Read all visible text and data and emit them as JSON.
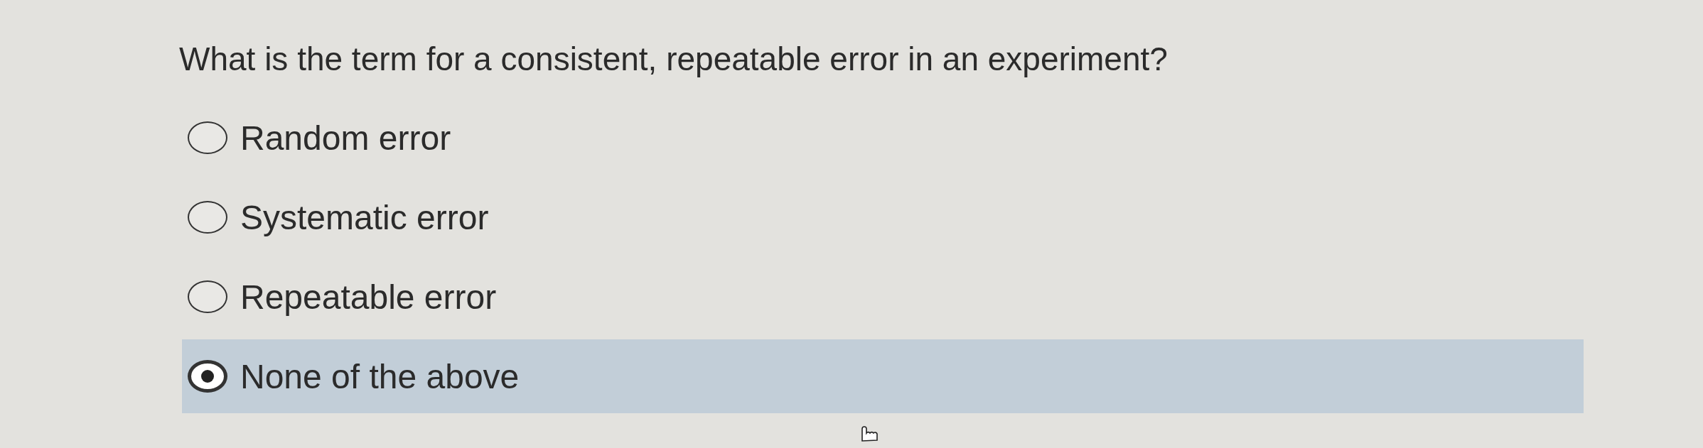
{
  "question": "What is the term for a consistent, repeatable error in an experiment?",
  "options": [
    {
      "label": "Random error",
      "selected": false
    },
    {
      "label": "Systematic error",
      "selected": false
    },
    {
      "label": "Repeatable error",
      "selected": false
    },
    {
      "label": "None of the above",
      "selected": true
    }
  ]
}
